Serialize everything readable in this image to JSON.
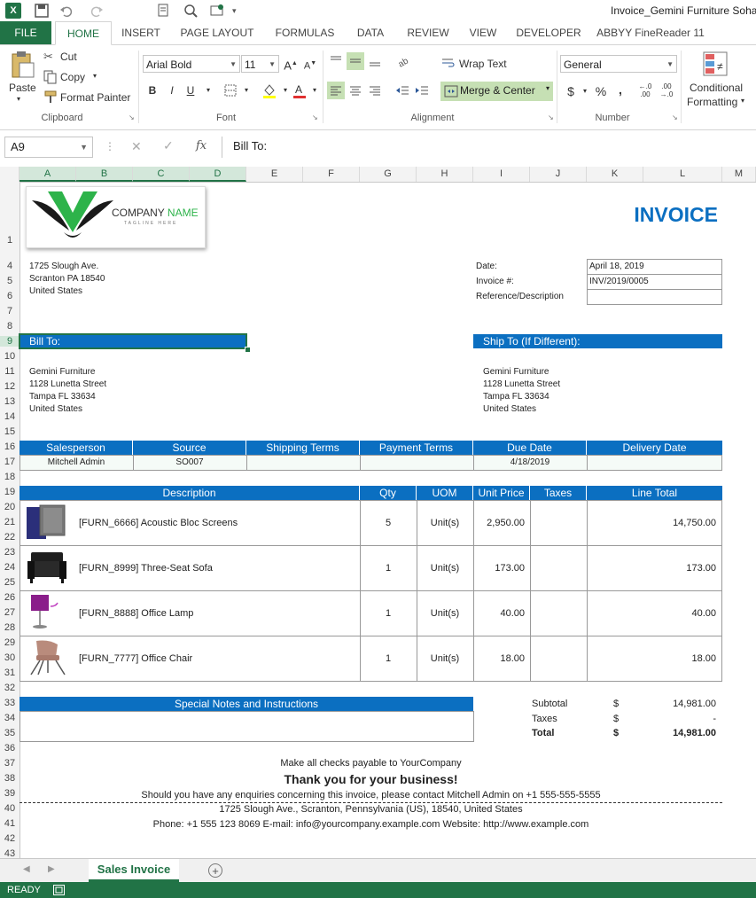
{
  "window": {
    "title": "Invoice_Gemini Furniture Sohar"
  },
  "ribbon_tabs": [
    "FILE",
    "HOME",
    "INSERT",
    "PAGE LAYOUT",
    "FORMULAS",
    "DATA",
    "REVIEW",
    "VIEW",
    "DEVELOPER",
    "ABBYY FineReader 11"
  ],
  "clipboard": {
    "paste": "Paste",
    "cut": "Cut",
    "copy": "Copy",
    "format_painter": "Format Painter",
    "label": "Clipboard"
  },
  "font": {
    "name": "Arial Bold",
    "size": "11",
    "label": "Font",
    "bold": "B",
    "italic": "I",
    "underline": "U"
  },
  "alignment": {
    "wrap_text": "Wrap Text",
    "merge_center": "Merge & Center",
    "label": "Alignment"
  },
  "number": {
    "format": "General",
    "label": "Number",
    "currency": "$",
    "percent": "%",
    "comma": ","
  },
  "styles": {
    "conditional_formatting_1": "Conditional",
    "conditional_formatting_2": "Formatting"
  },
  "formula_bar": {
    "name_box": "A9",
    "formula": "Bill To:",
    "fx": "fx"
  },
  "columns": [
    "A",
    "B",
    "C",
    "D",
    "E",
    "F",
    "G",
    "H",
    "I",
    "J",
    "K",
    "L",
    "M"
  ],
  "rows": [
    "1",
    "4",
    "5",
    "6",
    "7",
    "8",
    "9",
    "10",
    "11",
    "12",
    "13",
    "14",
    "15",
    "16",
    "17",
    "18",
    "19",
    "20",
    "21",
    "22",
    "23",
    "24",
    "25",
    "26",
    "27",
    "28",
    "29",
    "30",
    "31",
    "32",
    "33",
    "34",
    "35",
    "36",
    "37",
    "38",
    "39",
    "40",
    "41",
    "42",
    "43"
  ],
  "invoice": {
    "logo": {
      "company": "COMPANY",
      "name": "NAME",
      "tagline": "TAGLINE HERE"
    },
    "heading": "INVOICE",
    "from_address": [
      "1725 Slough Ave.",
      "Scranton PA 18540",
      "United States"
    ],
    "meta": [
      {
        "label": "Date:",
        "value": "April 18, 2019"
      },
      {
        "label": "Invoice #:",
        "value": "INV/2019/0005"
      },
      {
        "label": "Reference/Description",
        "value": ""
      }
    ],
    "bill_to_label": "Bill To:",
    "ship_to_label": "Ship To (If Different):",
    "bill_to": [
      "Gemini Furniture",
      "1128 Lunetta Street",
      "Tampa FL 33634",
      "United States"
    ],
    "ship_to": [
      "Gemini Furniture",
      "1128 Lunetta Street",
      "Tampa FL 33634",
      "United States"
    ],
    "terms_headers": [
      "Salesperson",
      "Source",
      "Shipping Terms",
      "Payment Terms",
      "Due Date",
      "Delivery Date"
    ],
    "terms_values": [
      "Mitchell Admin",
      "SO007",
      "",
      "",
      "4/18/2019",
      ""
    ],
    "line_headers": [
      "Description",
      "Qty",
      "UOM",
      "Unit Price",
      "Taxes",
      "Line Total"
    ],
    "lines": [
      {
        "description": "[FURN_6666] Acoustic Bloc Screens",
        "qty": "5",
        "uom": "Unit(s)",
        "unit_price": "2,950.00",
        "taxes": "",
        "total": "14,750.00",
        "icon": "acoustic-screen-icon"
      },
      {
        "description": "[FURN_8999] Three-Seat Sofa",
        "qty": "1",
        "uom": "Unit(s)",
        "unit_price": "173.00",
        "taxes": "",
        "total": "173.00",
        "icon": "sofa-icon"
      },
      {
        "description": "[FURN_8888] Office Lamp",
        "qty": "1",
        "uom": "Unit(s)",
        "unit_price": "40.00",
        "taxes": "",
        "total": "40.00",
        "icon": "lamp-icon"
      },
      {
        "description": "[FURN_7777] Office Chair",
        "qty": "1",
        "uom": "Unit(s)",
        "unit_price": "18.00",
        "taxes": "",
        "total": "18.00",
        "icon": "chair-icon"
      }
    ],
    "notes_label": "Special Notes and Instructions",
    "totals": [
      {
        "label": "Subtotal",
        "currency": "$",
        "value": "14,981.00"
      },
      {
        "label": "Taxes",
        "currency": "$",
        "value": "-"
      },
      {
        "label": "Total",
        "currency": "$",
        "value": "14,981.00"
      }
    ],
    "footer": {
      "checks": "Make all checks payable to YourCompany",
      "thanks": "Thank you for your business!",
      "enquiries": "Should you have any enquiries concerning this invoice, please contact Mitchell Admin on +1 555-555-5555",
      "address": "1725 Slough Ave., Scranton, Pennsylvania (US), 18540, United States",
      "contact": "Phone: +1 555 123 8069 E-mail: info@yourcompany.example.com Website: http://www.example.com"
    }
  },
  "sheet_tab": "Sales Invoice",
  "status": "READY",
  "colors": {
    "excel_green": "#217346",
    "accent_blue": "#0b6fc1"
  }
}
